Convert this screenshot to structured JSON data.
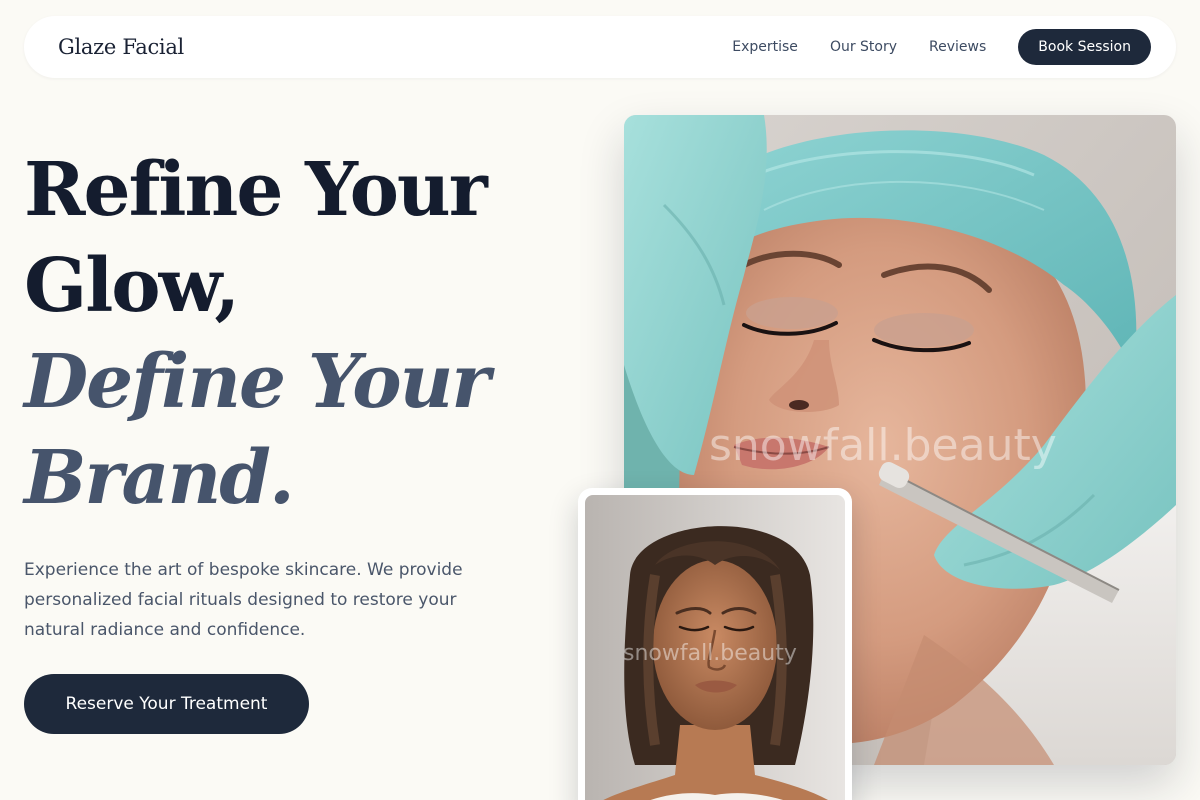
{
  "brand": {
    "name": "Glaze Facial"
  },
  "nav": {
    "links": [
      {
        "label": "Expertise"
      },
      {
        "label": "Our Story"
      },
      {
        "label": "Reviews"
      }
    ],
    "cta_label": "Book Session"
  },
  "hero": {
    "title_line1": "Refine Your",
    "title_line2": "Glow,",
    "title_line3": "Define Your",
    "title_line4": "Brand.",
    "description": "Experience the art of bespoke skincare. We provide personalized facial rituals designed to restore your natural radiance and confidence.",
    "cta_label": "Reserve Your Treatment"
  },
  "images": {
    "main_watermark": "snowfall.beauty",
    "small_watermark": "snowfall.beauty"
  },
  "colors": {
    "background": "#fbfaf5",
    "primary_dark": "#1e293b",
    "title_text": "#141c2e",
    "italic_accent": "#46546c",
    "glove_teal": "#8fd0cc"
  }
}
